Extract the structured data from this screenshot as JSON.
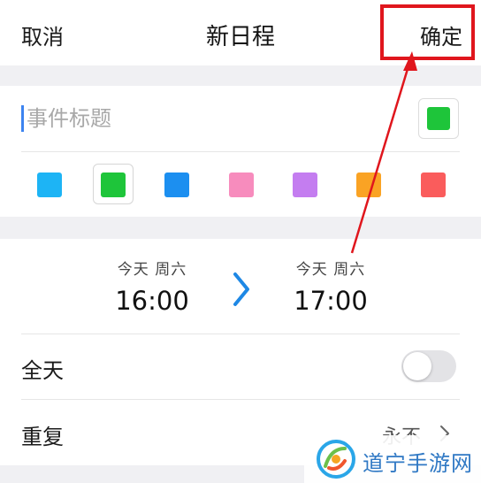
{
  "navbar": {
    "cancel": "取消",
    "title": "新日程",
    "confirm": "确定"
  },
  "event": {
    "title_placeholder": "事件标题",
    "title_value": "",
    "selected_color": "#1ec53a",
    "colors": [
      {
        "name": "cyan",
        "hex": "#1db4f5"
      },
      {
        "name": "green",
        "hex": "#1ec53a"
      },
      {
        "name": "blue",
        "hex": "#1c8ff0"
      },
      {
        "name": "pink",
        "hex": "#f78cbd"
      },
      {
        "name": "purple",
        "hex": "#c47df0"
      },
      {
        "name": "orange",
        "hex": "#faa324"
      },
      {
        "name": "red",
        "hex": "#fa5c5c"
      }
    ],
    "selected_index": 1
  },
  "time": {
    "start_day": "今天 周六",
    "start_time": "16:00",
    "end_day": "今天 周六",
    "end_time": "17:00",
    "arrow_icon": "chevron-right-icon",
    "accent": "#1e88e5"
  },
  "options": {
    "all_day_label": "全天",
    "all_day_on": false,
    "repeat_label": "重复",
    "repeat_value": "永不"
  },
  "annotation": {
    "color": "#e0161d"
  },
  "watermark": {
    "text": "道宁手游网"
  }
}
